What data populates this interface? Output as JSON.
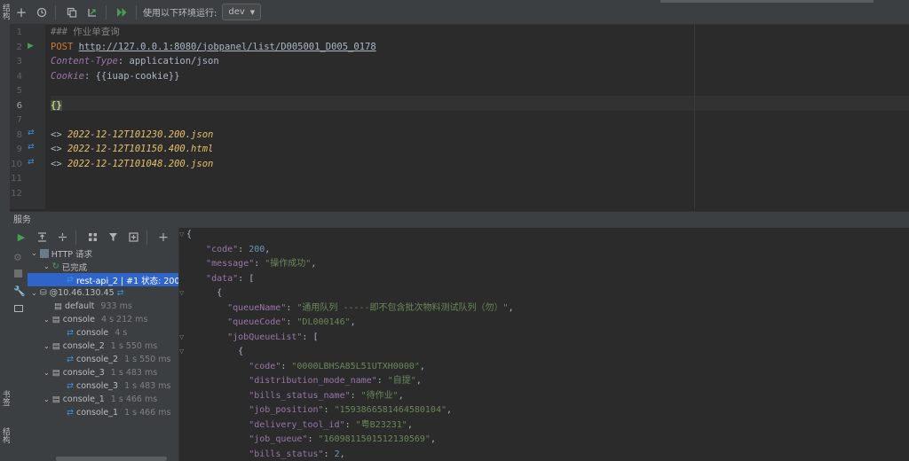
{
  "left_strip": {
    "tab_top": "结构",
    "tab_bottom_1": "书签",
    "tab_bottom_2": "结构"
  },
  "toolbar": {
    "icons": [
      "add-icon",
      "history-icon",
      "copy-icon",
      "convert-icon",
      "run-all-icon"
    ],
    "env_label": "使用以下环境运行:",
    "env_value": "dev"
  },
  "editor": {
    "line_numbers": [
      "1",
      "2",
      "3",
      "4",
      "5",
      "6",
      "7",
      "8",
      "9",
      "10",
      "11",
      "12"
    ],
    "comment": "### 作业单查询",
    "method": "POST",
    "url": "http://127.0.0.1:8080/jobpanel/list/D005001_D005_0178",
    "header1_key": "Content-Type",
    "header1_val": "application/json",
    "header2_key": "Cookie",
    "header2_val": "{{iuap-cookie}}",
    "body": "{}",
    "history": [
      {
        "prefix": "<>",
        "file": "2022-12-12T101230.200.json"
      },
      {
        "prefix": "<>",
        "file": "2022-12-12T101150.400.html"
      },
      {
        "prefix": "<>",
        "file": "2022-12-12T101048.200.json"
      }
    ]
  },
  "services": {
    "title": "服务",
    "tree": {
      "http_root": "HTTP 请求",
      "done": "已完成",
      "selected_request": "rest-api_2 | #1 状态: 200 (",
      "host": "@10.46.130.45",
      "default_label": "default",
      "default_time": "933 ms",
      "consoles": [
        {
          "name": "console",
          "time": "4 s 212 ms",
          "child": "console",
          "child_time": "4 s"
        },
        {
          "name": "console_2",
          "time": "1 s 550 ms",
          "child": "console_2",
          "child_time": "1 s 550 ms"
        },
        {
          "name": "console_3",
          "time": "1 s 483 ms",
          "child": "console_3",
          "child_time": "1 s 483 ms"
        },
        {
          "name": "console_1",
          "time": "1 s 466 ms",
          "child": "console_1",
          "child_time": "1 s 466 ms"
        }
      ]
    },
    "response": {
      "code_key": "\"code\"",
      "code_val": "200",
      "message_key": "\"message\"",
      "message_val": "\"操作成功\"",
      "data_key": "\"data\"",
      "queueName_key": "\"queueName\"",
      "queueName_val": "\"通用队列 -----即不包含批次物料测试队列（勿）\"",
      "queueCode_key": "\"queueCode\"",
      "queueCode_val": "\"DL000146\"",
      "jobQueueList_key": "\"jobQueueList\"",
      "item_code_key": "\"code\"",
      "item_code_val": "\"0000LBHSA85L51UTXH0000\"",
      "dist_key": "\"distribution_mode_name\"",
      "dist_val": "\"自提\"",
      "bsn_key": "\"bills_status_name\"",
      "bsn_val": "\"待作业\"",
      "jp_key": "\"job_position\"",
      "jp_val": "\"1593866581464580104\"",
      "dt_key": "\"delivery_tool_id\"",
      "dt_val": "\"粤B23231\"",
      "jq_key": "\"job_queue\"",
      "jq_val": "\"1609811501512130569\"",
      "bs_key": "\"bills_status\"",
      "bs_val": "2"
    }
  }
}
